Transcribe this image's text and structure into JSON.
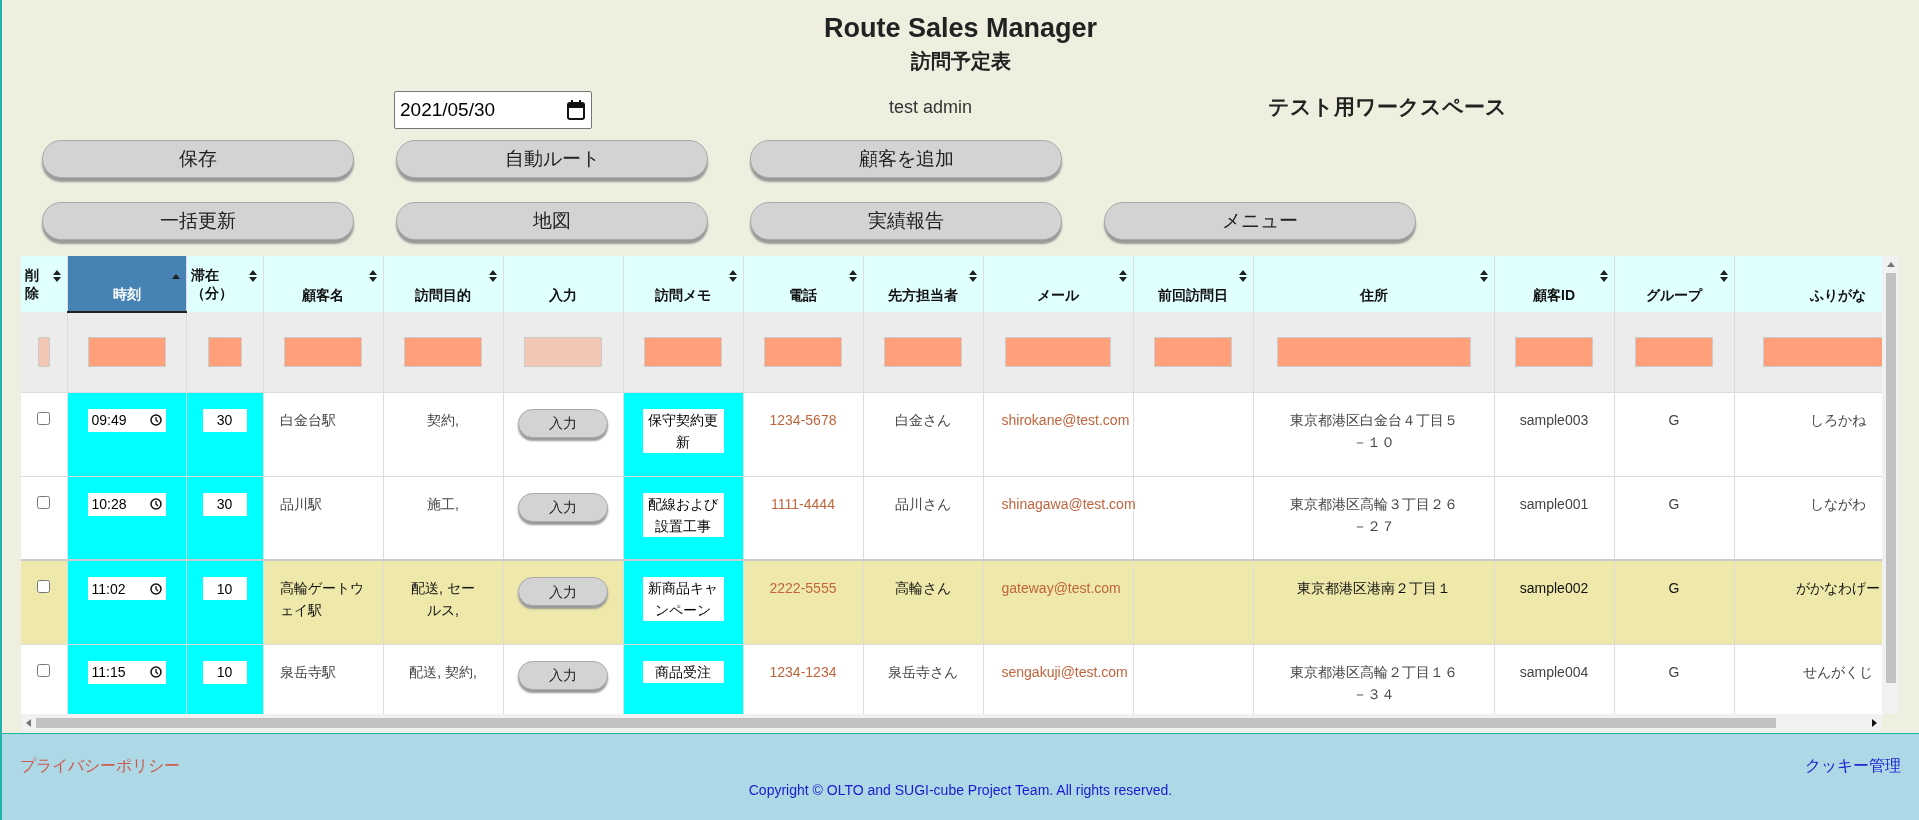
{
  "header": {
    "title": "Route Sales Manager",
    "subtitle": "訪問予定表",
    "date": "2021/05/30",
    "user": "test admin",
    "workspace": "テスト用ワークスペース"
  },
  "button_rows": [
    [
      "保存",
      "自動ルート",
      "顧客を追加"
    ],
    [
      "一括更新",
      "地図",
      "実績報告",
      "メニュー"
    ]
  ],
  "table": {
    "columns": [
      {
        "label": "削除",
        "sortable": true,
        "selected": false,
        "highlight": false,
        "filter_disabled": true
      },
      {
        "label": "時刻",
        "sortable": true,
        "selected": true,
        "highlight": true,
        "filter_disabled": false
      },
      {
        "label": "滞在（分）",
        "sortable": true,
        "selected": false,
        "highlight": true,
        "filter_disabled": false
      },
      {
        "label": "顧客名",
        "sortable": true,
        "selected": false,
        "highlight": false,
        "filter_disabled": false
      },
      {
        "label": "訪問目的",
        "sortable": true,
        "selected": false,
        "highlight": false,
        "filter_disabled": false
      },
      {
        "label": "入力",
        "sortable": false,
        "selected": false,
        "highlight": false,
        "filter_disabled": true
      },
      {
        "label": "訪問メモ",
        "sortable": true,
        "selected": false,
        "highlight": true,
        "filter_disabled": false
      },
      {
        "label": "電話",
        "sortable": true,
        "selected": false,
        "highlight": false,
        "filter_disabled": false
      },
      {
        "label": "先方担当者",
        "sortable": true,
        "selected": false,
        "highlight": false,
        "filter_disabled": false
      },
      {
        "label": "メール",
        "sortable": true,
        "selected": false,
        "highlight": false,
        "filter_disabled": false
      },
      {
        "label": "前回訪問日",
        "sortable": true,
        "selected": false,
        "highlight": false,
        "filter_disabled": false
      },
      {
        "label": "住所",
        "sortable": true,
        "selected": false,
        "highlight": false,
        "filter_disabled": false
      },
      {
        "label": "顧客ID",
        "sortable": true,
        "selected": false,
        "highlight": false,
        "filter_disabled": false
      },
      {
        "label": "グループ",
        "sortable": true,
        "selected": false,
        "highlight": false,
        "filter_disabled": false
      },
      {
        "label": "ふりがな",
        "selected": false,
        "highlight": false,
        "filter_disabled": false
      }
    ],
    "rows": [
      {
        "selected": false,
        "checked": false,
        "time": "09:49",
        "stay": "30",
        "customer": "白金台駅",
        "purpose": "契約,",
        "input_button": "入力",
        "memo": "保守契約更新",
        "phone": "1234-5678",
        "contact": "白金さん",
        "email": "shirokane@test.com",
        "address": "東京都港区白金台４丁目５－１０",
        "customer_id": "sample003",
        "group": "G",
        "furigana": "しろかね"
      },
      {
        "selected": false,
        "checked": false,
        "time": "10:28",
        "stay": "30",
        "customer": "品川駅",
        "purpose": "施工,",
        "input_button": "入力",
        "memo": "配線および設置工事",
        "phone": "1111-4444",
        "contact": "品川さん",
        "email": "shinagawa@test.com",
        "address": "東京都港区高輪３丁目２６－２７",
        "customer_id": "sample001",
        "group": "G",
        "furigana": "しながわ"
      },
      {
        "selected": true,
        "checked": false,
        "time": "11:02",
        "stay": "10",
        "customer": "高輪ゲートウェイ駅",
        "purpose": "配送, セールス,",
        "input_button": "入力",
        "memo": "新商品キャンペーン",
        "phone": "2222-5555",
        "contact": "高輪さん",
        "email": "gateway@test.com",
        "address": "東京都港区港南２丁目１",
        "customer_id": "sample002",
        "group": "G",
        "furigana": "がかなわげー"
      },
      {
        "selected": false,
        "checked": false,
        "time": "11:15",
        "stay": "10",
        "customer": "泉岳寺駅",
        "purpose": "配送, 契約,",
        "input_button": "入力",
        "memo": "商品受注",
        "phone": "1234-1234",
        "contact": "泉岳寺さん",
        "email": "sengakuji@test.com",
        "address": "東京都港区高輪２丁目１６－３４",
        "customer_id": "sample004",
        "group": "G",
        "furigana": "せんがくじ"
      }
    ]
  },
  "footer": {
    "privacy_link": "プライバシーポリシー",
    "copyright": "Copyright © OLTO and SUGI-cube Project Team. All rights reserved.",
    "cookie_link": "クッキー管理"
  }
}
